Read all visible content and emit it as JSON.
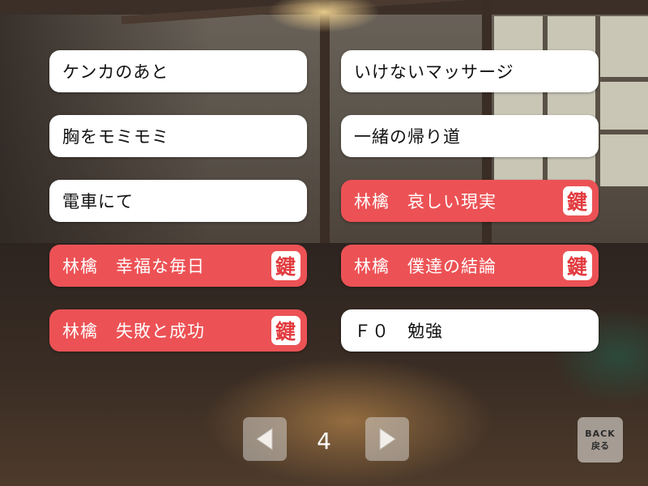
{
  "scenes": {
    "left": [
      {
        "label": "ケンカのあと",
        "locked": false
      },
      {
        "label": "胸をモミモミ",
        "locked": false
      },
      {
        "label": "電車にて",
        "locked": false
      },
      {
        "label": "林檎　幸福な毎日",
        "locked": true
      },
      {
        "label": "林檎　失敗と成功",
        "locked": true
      }
    ],
    "right": [
      {
        "label": "いけないマッサージ",
        "locked": false
      },
      {
        "label": "一緒の帰り道",
        "locked": false
      },
      {
        "label": "林檎　哀しい現実",
        "locked": true
      },
      {
        "label": "林檎　僕達の結論",
        "locked": true
      },
      {
        "label": "Ｆ０　勉強",
        "locked": false
      }
    ]
  },
  "lock_glyph": "鍵",
  "pagination": {
    "page": "4",
    "prev_icon": "left-triangle-icon",
    "next_icon": "right-triangle-icon"
  },
  "back_button": {
    "label_en": "BACK",
    "label_jp": "戻る"
  },
  "colors": {
    "scene_button": "#ffffff",
    "locked_button": "#ec5255",
    "lock_icon_text": "#e23b3f"
  }
}
